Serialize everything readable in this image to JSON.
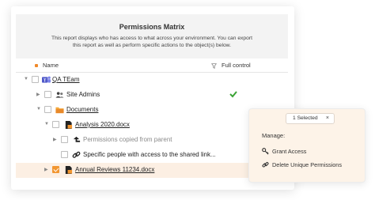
{
  "report": {
    "title": "Permissions Matrix",
    "description": "This report displays who has access to what across your environment. You can export this report as well as perform specific actions to the object(s) below."
  },
  "columns": {
    "name": "Name",
    "full_control": "Full control"
  },
  "rows": [
    {
      "label": "QA TEam",
      "icon": "teams-icon"
    },
    {
      "label": "Site Admins",
      "icon": "users-icon",
      "full_control": true
    },
    {
      "label": "Documents",
      "icon": "folder-icon"
    },
    {
      "label": "Analysis 2020.docx",
      "icon": "document-icon"
    },
    {
      "label": "Permissions copied from parent",
      "icon": "inherit-arrow-icon"
    },
    {
      "label": "Specific people with access to the shared link...",
      "icon": "link-icon"
    },
    {
      "label": "Annual Reviews 11234.docx",
      "icon": "document-icon",
      "selected": true
    }
  ],
  "popup": {
    "selected_label": "1 Selected",
    "close": "×",
    "manage": "Manage:",
    "actions": [
      {
        "label": "Grant Access",
        "icon": "key-icon"
      },
      {
        "label": "Delete Unique Permissions",
        "icon": "link-icon"
      }
    ]
  },
  "colors": {
    "accent": "#f29630",
    "check_green": "#3aa335",
    "selected_row": "#fcefe3"
  }
}
